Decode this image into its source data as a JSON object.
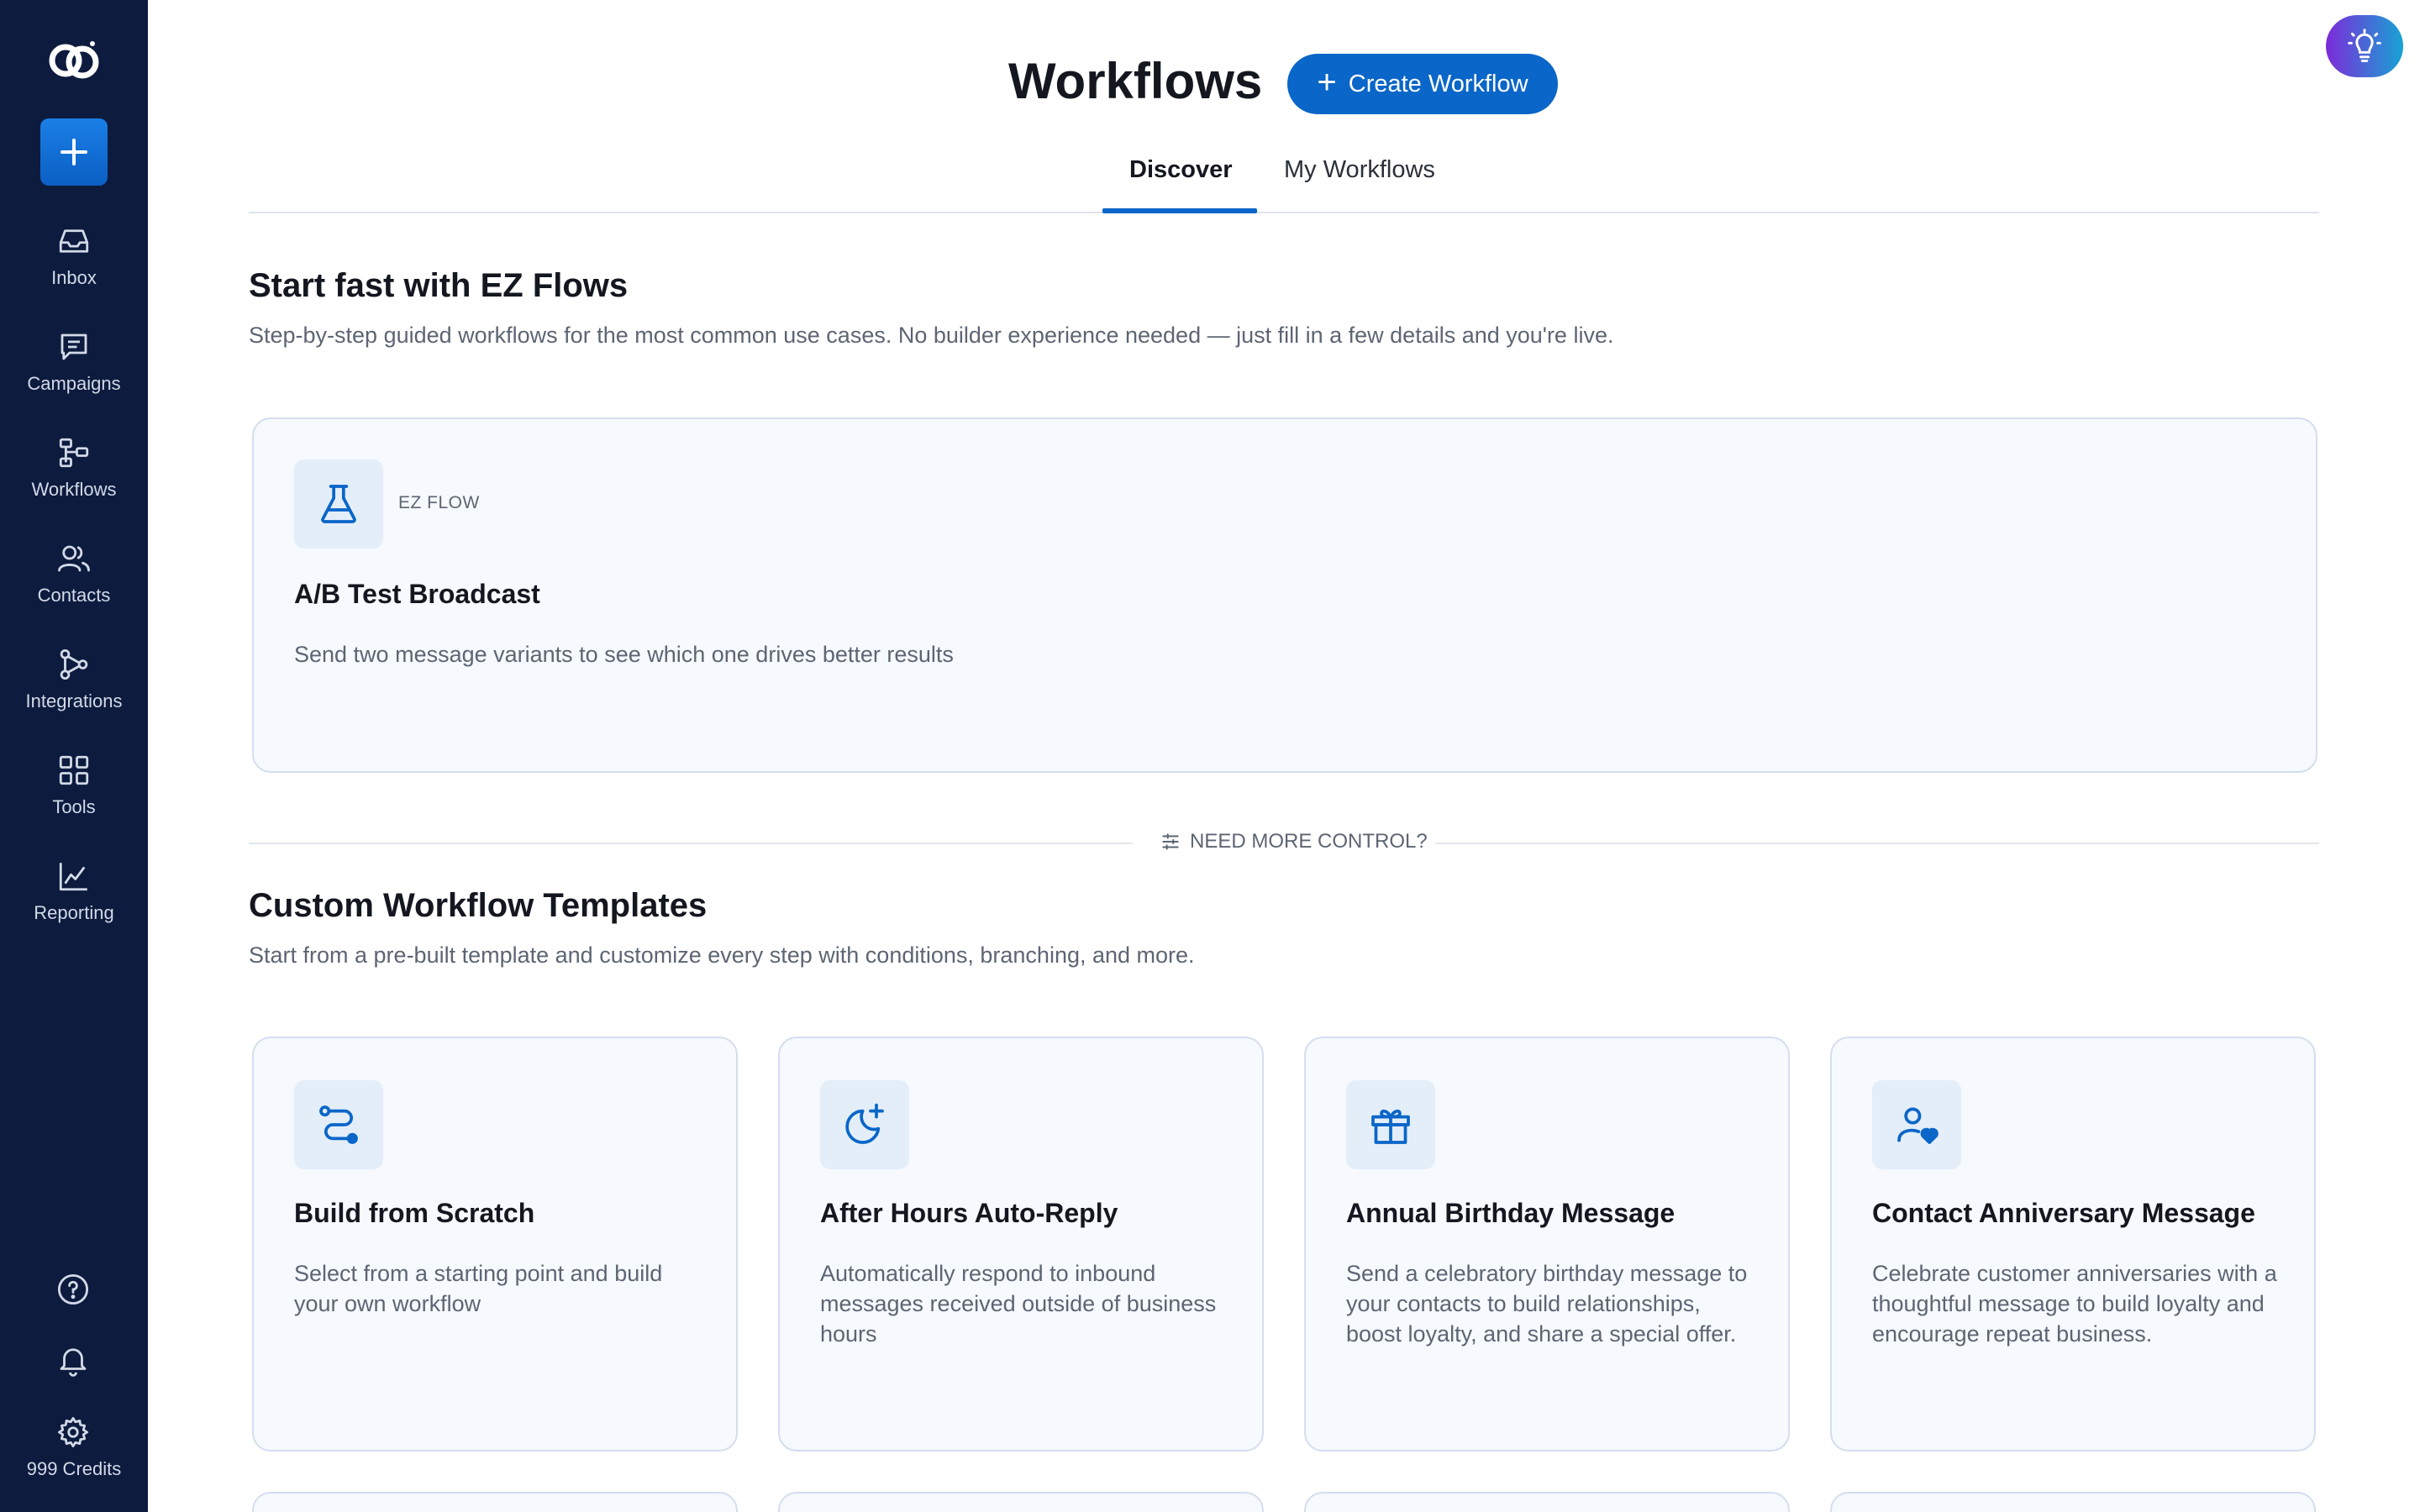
{
  "sidebar": {
    "logo_icon": "brand-logo-icon",
    "new_button_icon": "plus-icon",
    "items": [
      {
        "label": "Inbox",
        "icon": "inbox-icon"
      },
      {
        "label": "Campaigns",
        "icon": "chat-icon"
      },
      {
        "label": "Workflows",
        "icon": "workflow-icon"
      },
      {
        "label": "Contacts",
        "icon": "contacts-icon"
      },
      {
        "label": "Integrations",
        "icon": "integrations-icon"
      },
      {
        "label": "Tools",
        "icon": "grid-icon"
      },
      {
        "label": "Reporting",
        "icon": "chart-icon"
      }
    ],
    "bottom_icons": [
      "help-icon",
      "bell-icon",
      "gear-icon"
    ],
    "credits": "999 Credits"
  },
  "header": {
    "title": "Workflows",
    "create_button": "Create Workflow",
    "hint_icon": "lightbulb-icon"
  },
  "tabs": [
    {
      "label": "Discover",
      "active": true
    },
    {
      "label": "My Workflows",
      "active": false
    }
  ],
  "ez_section": {
    "title": "Start fast with EZ Flows",
    "subtitle": "Step-by-step guided workflows for the most common use cases. No builder experience needed — just fill in a few details and you're live.",
    "card": {
      "badge": "EZ FLOW",
      "title": "A/B Test Broadcast",
      "description": "Send two message variants to see which one drives better results",
      "icon": "flask-icon"
    }
  },
  "divider": {
    "label": "NEED MORE CONTROL?",
    "icon": "sliders-icon"
  },
  "templates_section": {
    "title": "Custom Workflow Templates",
    "subtitle": "Start from a pre-built template and customize every step with conditions, branching, and more.",
    "cards": [
      {
        "title": "Build from Scratch",
        "description": "Select from a starting point and build your own workflow",
        "icon": "route-icon"
      },
      {
        "title": "After Hours Auto-Reply",
        "description": "Automatically respond to inbound messages received outside of business hours",
        "icon": "moon-plus-icon"
      },
      {
        "title": "Annual Birthday Message",
        "description": "Send a celebratory birthday message to your contacts to build relationships, boost loyalty, and share a special offer.",
        "icon": "gift-icon"
      },
      {
        "title": "Contact Anniversary Message",
        "description": "Celebrate customer anniversaries with a thoughtful message to build loyalty and encourage repeat business.",
        "icon": "user-heart-icon"
      }
    ]
  },
  "colors": {
    "sidebar_bg": "#0d1b3e",
    "accent": "#0a66c8",
    "card_bg": "#f6f9fd",
    "card_border": "#d4deef",
    "icon_tile_bg": "#e3eef9"
  }
}
